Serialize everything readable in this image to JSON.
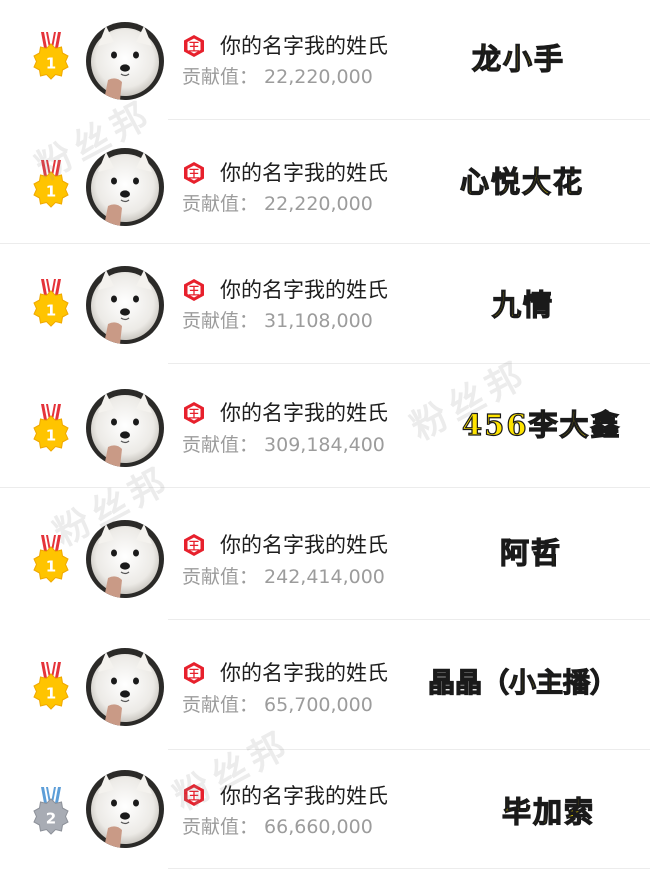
{
  "watermark": "粉丝邦",
  "contribution_label": "贡献值：",
  "badge_char": "王",
  "colors": {
    "tag_fill": "#ffe400",
    "gold": "#ffc400",
    "silver": "#a8acb4",
    "badge_red": "#e7202c"
  },
  "rows": [
    {
      "rank": "1",
      "medal": "gold",
      "name": "你的名字我的姓氏",
      "value": "22,220,000",
      "tag": "龙小手"
    },
    {
      "rank": "1",
      "medal": "gold",
      "name": "你的名字我的姓氏",
      "value": "22,220,000",
      "tag": "心悦大花"
    },
    {
      "rank": "1",
      "medal": "gold",
      "name": "你的名字我的姓氏",
      "value": "31,108,000",
      "tag": "九情"
    },
    {
      "rank": "1",
      "medal": "gold",
      "name": "你的名字我的姓氏",
      "value": "309,184,400",
      "tag": "456李大鑫"
    },
    {
      "rank": "1",
      "medal": "gold",
      "name": "你的名字我的姓氏",
      "value": "242,414,000",
      "tag": "阿哲"
    },
    {
      "rank": "1",
      "medal": "gold",
      "name": "你的名字我的姓氏",
      "value": "65,700,000",
      "tag": "晶晶（小主播）"
    },
    {
      "rank": "2",
      "medal": "silver",
      "name": "你的名字我的姓氏",
      "value": "66,660,000",
      "tag": "毕加索"
    }
  ]
}
